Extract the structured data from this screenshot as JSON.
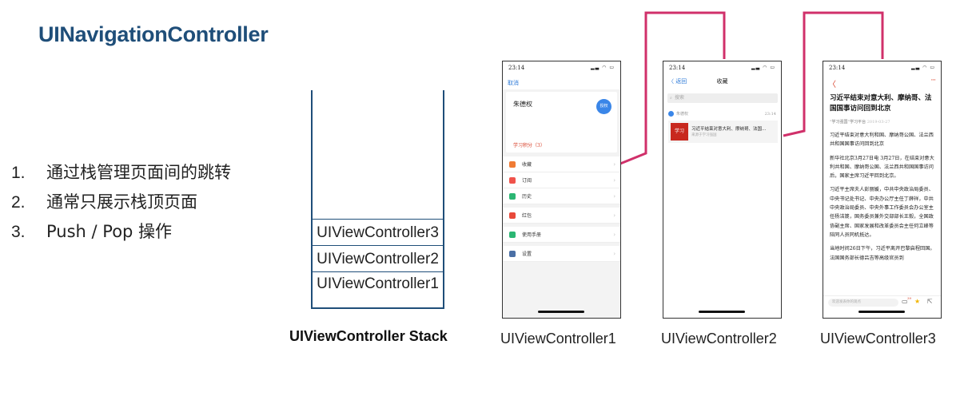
{
  "title": "UINavigationController",
  "points": [
    {
      "num": "1.",
      "text": "通过栈管理页面间的跳转"
    },
    {
      "num": "2.",
      "text": "通常只展示栈顶页面"
    },
    {
      "num": "3.",
      "text": "Push / Pop 操作"
    }
  ],
  "stack": {
    "items": [
      "UIViewController3",
      "UIViewController2",
      "UIViewController1"
    ],
    "caption": "UIViewController Stack"
  },
  "colors": {
    "title": "#1f4e79",
    "stack_border": "#1f4e79",
    "connector": "#d0306a",
    "accent_red": "#d9432c",
    "accent_blue": "#2f7bd8"
  },
  "phones": {
    "status_time": "23:14",
    "p1": {
      "caption": "UIViewController1",
      "cancel": "取消",
      "name": "朱德权",
      "avatar": "授权",
      "score": "学习积分（3）",
      "menu": [
        {
          "label": "收藏",
          "icon": "star-icon",
          "color": "#f07b34"
        },
        {
          "label": "订阅",
          "icon": "subscribe-icon",
          "color": "#f0534b"
        },
        {
          "label": "历史",
          "icon": "history-icon",
          "color": "#2bb673"
        },
        {
          "label": "红包",
          "icon": "red-envelope-icon",
          "color": "#e8493a"
        },
        {
          "label": "使用手册",
          "icon": "manual-icon",
          "color": "#2bb673"
        },
        {
          "label": "设置",
          "icon": "settings-icon",
          "color": "#4a6fa5"
        }
      ]
    },
    "p2": {
      "caption": "UIViewController2",
      "back": "〈 返回",
      "title": "收藏",
      "search": "搜索",
      "user": "朱德权",
      "time": "23:14",
      "thumb": "学习",
      "item_title": "习近平结束对意大利、摩纳哥、法国…",
      "item_source": "来源于学习强国"
    },
    "p3": {
      "caption": "UIViewController3",
      "back": "〈",
      "more": "···",
      "headline": "习近平结束对意大利、摩纳哥、法国国事访问回到北京",
      "source": "“学习强国”学习平台",
      "date": "2019-03-27",
      "paragraphs": [
        "习近平结束对意大利和国、摩纳哥公国、法兰西共和国国事访问回到北京",
        "新华社北京3月27日电 3月27日，在结束对意大利共和国、摩纳哥公国、法兰西共和国国事访问后，国家主席习近平回到北京。",
        "习近平主席夫人彭丽媛，中共中央政治局委员、中央书记处书记、中央办公厅主任丁薛祥，中共中央政治局委员、中央外事工作委员会办公室主任杨洁篪，国务委员兼外交部部长王毅，全国政协副主席、国家发展和改革委员会主任何立峰等陪同人员同机抵达。",
        "当地时间26日下午，习近平离开巴黎启程回国。法国国务部长德吕吉等高级官员到"
      ],
      "input_placeholder": "欢迎发表你的观点",
      "comment_count": "39"
    }
  }
}
